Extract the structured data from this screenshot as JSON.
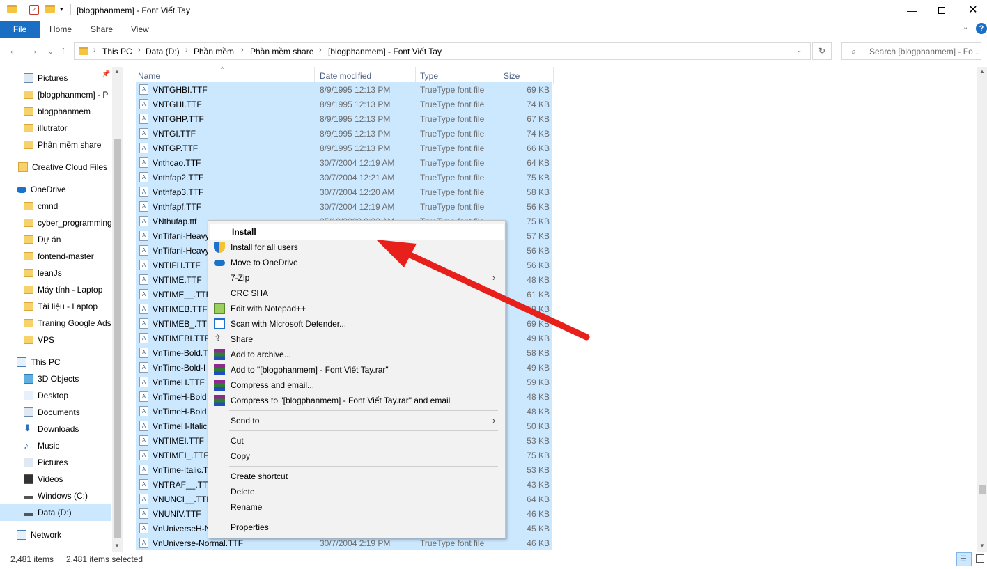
{
  "window": {
    "title": "[blogphanmem] - Font Viết Tay",
    "minimize_icon": "minimize-icon",
    "maximize_icon": "maximize-icon",
    "close_icon": "close-icon"
  },
  "ribbon": {
    "file": "File",
    "tabs": [
      "Home",
      "Share",
      "View"
    ],
    "accent": "#1a6fc4"
  },
  "address": {
    "crumbs": [
      "This PC",
      "Data (D:)",
      "Phần mềm",
      "Phần mềm share",
      "[blogphanmem] - Font Viết Tay"
    ],
    "search_placeholder": "Search [blogphanmem] - Fo..."
  },
  "nav": {
    "items": [
      {
        "label": "Pictures",
        "icon": "pictures-icon"
      },
      {
        "label": "[blogphanmem] - P",
        "icon": "folder-icon"
      },
      {
        "label": "blogphanmem",
        "icon": "folder-icon"
      },
      {
        "label": "illutrator",
        "icon": "folder-icon"
      },
      {
        "label": "Phần mềm share",
        "icon": "folder-icon"
      },
      {
        "label": "Creative Cloud Files",
        "icon": "creative-cloud-icon"
      },
      {
        "label": "OneDrive",
        "icon": "onedrive-icon"
      },
      {
        "label": "cmnd",
        "icon": "folder-icon"
      },
      {
        "label": "cyber_programming",
        "icon": "folder-icon"
      },
      {
        "label": "Dự án",
        "icon": "folder-icon"
      },
      {
        "label": "fontend-master",
        "icon": "folder-icon"
      },
      {
        "label": "leanJs",
        "icon": "folder-icon"
      },
      {
        "label": "Máy tính - Laptop",
        "icon": "folder-icon"
      },
      {
        "label": "Tài liệu - Laptop",
        "icon": "folder-icon"
      },
      {
        "label": "Traning Google Ads",
        "icon": "folder-icon"
      },
      {
        "label": "VPS",
        "icon": "folder-icon"
      },
      {
        "label": "This PC",
        "icon": "this-pc-icon"
      },
      {
        "label": "3D Objects",
        "icon": "3d-objects-icon"
      },
      {
        "label": "Desktop",
        "icon": "desktop-icon"
      },
      {
        "label": "Documents",
        "icon": "documents-icon"
      },
      {
        "label": "Downloads",
        "icon": "downloads-icon"
      },
      {
        "label": "Music",
        "icon": "music-icon"
      },
      {
        "label": "Pictures",
        "icon": "pictures-icon"
      },
      {
        "label": "Videos",
        "icon": "videos-icon"
      },
      {
        "label": "Windows (C:)",
        "icon": "drive-icon"
      },
      {
        "label": "Data (D:)",
        "icon": "drive-icon"
      },
      {
        "label": "Network",
        "icon": "network-icon"
      }
    ]
  },
  "columns": [
    "Name",
    "Date modified",
    "Type",
    "Size"
  ],
  "files": [
    {
      "name": "VNTGHBI.TTF",
      "date": "8/9/1995 12:13 PM",
      "type": "TrueType font file",
      "size": "69 KB"
    },
    {
      "name": "VNTGHI.TTF",
      "date": "8/9/1995 12:13 PM",
      "type": "TrueType font file",
      "size": "74 KB"
    },
    {
      "name": "VNTGHP.TTF",
      "date": "8/9/1995 12:13 PM",
      "type": "TrueType font file",
      "size": "67 KB"
    },
    {
      "name": "VNTGI.TTF",
      "date": "8/9/1995 12:13 PM",
      "type": "TrueType font file",
      "size": "74 KB"
    },
    {
      "name": "VNTGP.TTF",
      "date": "8/9/1995 12:13 PM",
      "type": "TrueType font file",
      "size": "66 KB"
    },
    {
      "name": "Vnthcao.TTF",
      "date": "30/7/2004 12:19 AM",
      "type": "TrueType font file",
      "size": "64 KB"
    },
    {
      "name": "Vnthfap2.TTF",
      "date": "30/7/2004 12:21 AM",
      "type": "TrueType font file",
      "size": "75 KB"
    },
    {
      "name": "Vnthfap3.TTF",
      "date": "30/7/2004 12:20 AM",
      "type": "TrueType font file",
      "size": "58 KB"
    },
    {
      "name": "Vnthfapf.TTF",
      "date": "30/7/2004 12:19 AM",
      "type": "TrueType font file",
      "size": "56 KB"
    },
    {
      "name": "VNthufap.ttf",
      "date": "25/10/2003 9:33 AM",
      "type": "TrueType font file",
      "size": "75 KB"
    },
    {
      "name": "VnTifani-Heavy",
      "date": "",
      "type": "",
      "size": "57 KB"
    },
    {
      "name": "VnTifani-Heavy",
      "date": "",
      "type": "",
      "size": "56 KB"
    },
    {
      "name": "VNTIFH.TTF",
      "date": "",
      "type": "",
      "size": "56 KB"
    },
    {
      "name": "VNTIME.TTF",
      "date": "",
      "type": "",
      "size": "48 KB"
    },
    {
      "name": "VNTIME__.TTF",
      "date": "",
      "type": "",
      "size": "61 KB"
    },
    {
      "name": "VNTIMEB.TTF",
      "date": "",
      "type": "",
      "size": "58 KB"
    },
    {
      "name": "VNTIMEB_.TTF",
      "date": "",
      "type": "",
      "size": "69 KB"
    },
    {
      "name": "VNTIMEBI.TTF",
      "date": "",
      "type": "",
      "size": "49 KB"
    },
    {
      "name": "VnTime-Bold.T",
      "date": "",
      "type": "",
      "size": "58 KB"
    },
    {
      "name": "VnTime-Bold-I",
      "date": "",
      "type": "",
      "size": "49 KB"
    },
    {
      "name": "VnTimeH.TTF",
      "date": "",
      "type": "",
      "size": "59 KB"
    },
    {
      "name": "VnTimeH-Bold",
      "date": "",
      "type": "",
      "size": "48 KB"
    },
    {
      "name": "VnTimeH-Bold",
      "date": "",
      "type": "",
      "size": "48 KB"
    },
    {
      "name": "VnTimeH-Italic",
      "date": "",
      "type": "",
      "size": "50 KB"
    },
    {
      "name": "VNTIMEI.TTF",
      "date": "",
      "type": "",
      "size": "53 KB"
    },
    {
      "name": "VNTIMEI_.TTF",
      "date": "",
      "type": "",
      "size": "75 KB"
    },
    {
      "name": "VnTime-Italic.T",
      "date": "",
      "type": "",
      "size": "53 KB"
    },
    {
      "name": "VNTRAF__.TTF",
      "date": "",
      "type": "",
      "size": "43 KB"
    },
    {
      "name": "VNUNCI__.TTF",
      "date": "",
      "type": "",
      "size": "64 KB"
    },
    {
      "name": "VNUNIV.TTF",
      "date": "",
      "type": "",
      "size": "46 KB"
    },
    {
      "name": "VnUniverseH-N",
      "date": "",
      "type": "",
      "size": "45 KB"
    },
    {
      "name": "VnUniverse-Normal.TTF",
      "date": "30/7/2004 2:19 PM",
      "type": "TrueType font file",
      "size": "46 KB"
    }
  ],
  "status": {
    "count": "2,481 items",
    "selected": "2,481 items selected"
  },
  "context_menu": {
    "groups": [
      [
        {
          "label": "Install",
          "icon": "",
          "bold": true
        },
        {
          "label": "Install for all users",
          "icon": "shield-icon"
        },
        {
          "label": "Move to OneDrive",
          "icon": "onedrive-icon"
        },
        {
          "label": "7-Zip",
          "icon": "",
          "submenu": true
        },
        {
          "label": "CRC SHA",
          "icon": "",
          "submenu": true
        },
        {
          "label": "Edit with Notepad++",
          "icon": "notepadpp-icon"
        },
        {
          "label": "Scan with Microsoft Defender...",
          "icon": "defender-icon"
        },
        {
          "label": "Share",
          "icon": "share-icon"
        },
        {
          "label": "Add to archive...",
          "icon": "winrar-icon"
        },
        {
          "label": "Add to \"[blogphanmem] - Font Viết Tay.rar\"",
          "icon": "winrar-icon"
        },
        {
          "label": "Compress and email...",
          "icon": "winrar-icon"
        },
        {
          "label": "Compress to \"[blogphanmem] - Font Viết Tay.rar\" and email",
          "icon": "winrar-icon"
        }
      ],
      [
        {
          "label": "Send to",
          "icon": "",
          "submenu": true
        }
      ],
      [
        {
          "label": "Cut",
          "icon": ""
        },
        {
          "label": "Copy",
          "icon": ""
        }
      ],
      [
        {
          "label": "Create shortcut",
          "icon": ""
        },
        {
          "label": "Delete",
          "icon": ""
        },
        {
          "label": "Rename",
          "icon": ""
        }
      ],
      [
        {
          "label": "Properties",
          "icon": ""
        }
      ]
    ]
  },
  "annotation_color": "#e8201c",
  "selection_color": "#cce8ff"
}
